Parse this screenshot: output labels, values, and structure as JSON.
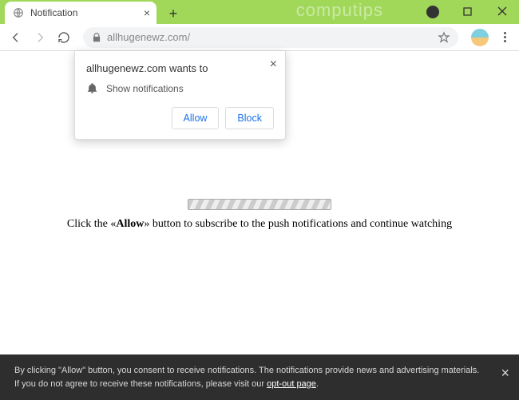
{
  "watermark": "computips",
  "tab": {
    "title": "Notification"
  },
  "omnibox": {
    "url_text": "allhugenewz.com/"
  },
  "prompt": {
    "origin_line": "allhugenewz.com wants to",
    "permission_label": "Show notifications",
    "allow": "Allow",
    "block": "Block"
  },
  "page": {
    "instruction_prefix": "Click the «",
    "instruction_bold": "Allow",
    "instruction_suffix": "» button to subscribe to the push notifications and continue watching"
  },
  "banner": {
    "text_a": "By clicking \"Allow\" button, you consent to receive notifications. The notifications provide news and advertising materials. If you do not agree to receive these notifications, please visit our ",
    "link": "opt-out page",
    "text_b": "."
  }
}
